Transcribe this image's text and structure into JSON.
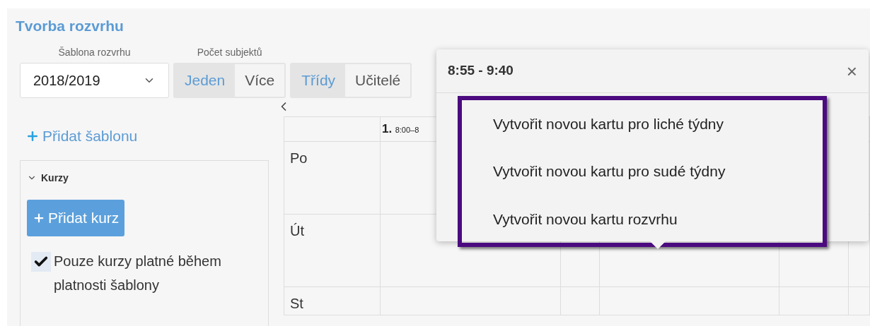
{
  "title": "Tvorba rozvrhu",
  "template": {
    "label": "Šablona rozvrhu",
    "value": "2018/2019"
  },
  "subject_count": {
    "label": "Počet subjektů",
    "options": [
      {
        "label": "Jeden",
        "selected": true
      },
      {
        "label": "Více",
        "selected": false
      }
    ]
  },
  "view_tabs": [
    {
      "label": "Třídy",
      "selected": true
    },
    {
      "label": "Učitelé",
      "selected": false
    }
  ],
  "add_template": "Přidat šablonu",
  "courses": {
    "title": "Kurzy",
    "expanded": true,
    "add_button": "Přidat kurz",
    "only_valid": {
      "label": "Pouze kurzy platné během platnosti šablony",
      "checked": true
    }
  },
  "grid": {
    "header": {
      "number": "1.",
      "time": "8:00–8"
    },
    "days": [
      "Po",
      "Út",
      "St"
    ]
  },
  "popover": {
    "title": "8:55 - 9:40",
    "close": "×",
    "items": [
      "Vytvořit novou kartu pro liché týdny",
      "Vytvořit novou kartu pro sudé týdny",
      "Vytvořit novou kartu rozvrhu"
    ]
  }
}
